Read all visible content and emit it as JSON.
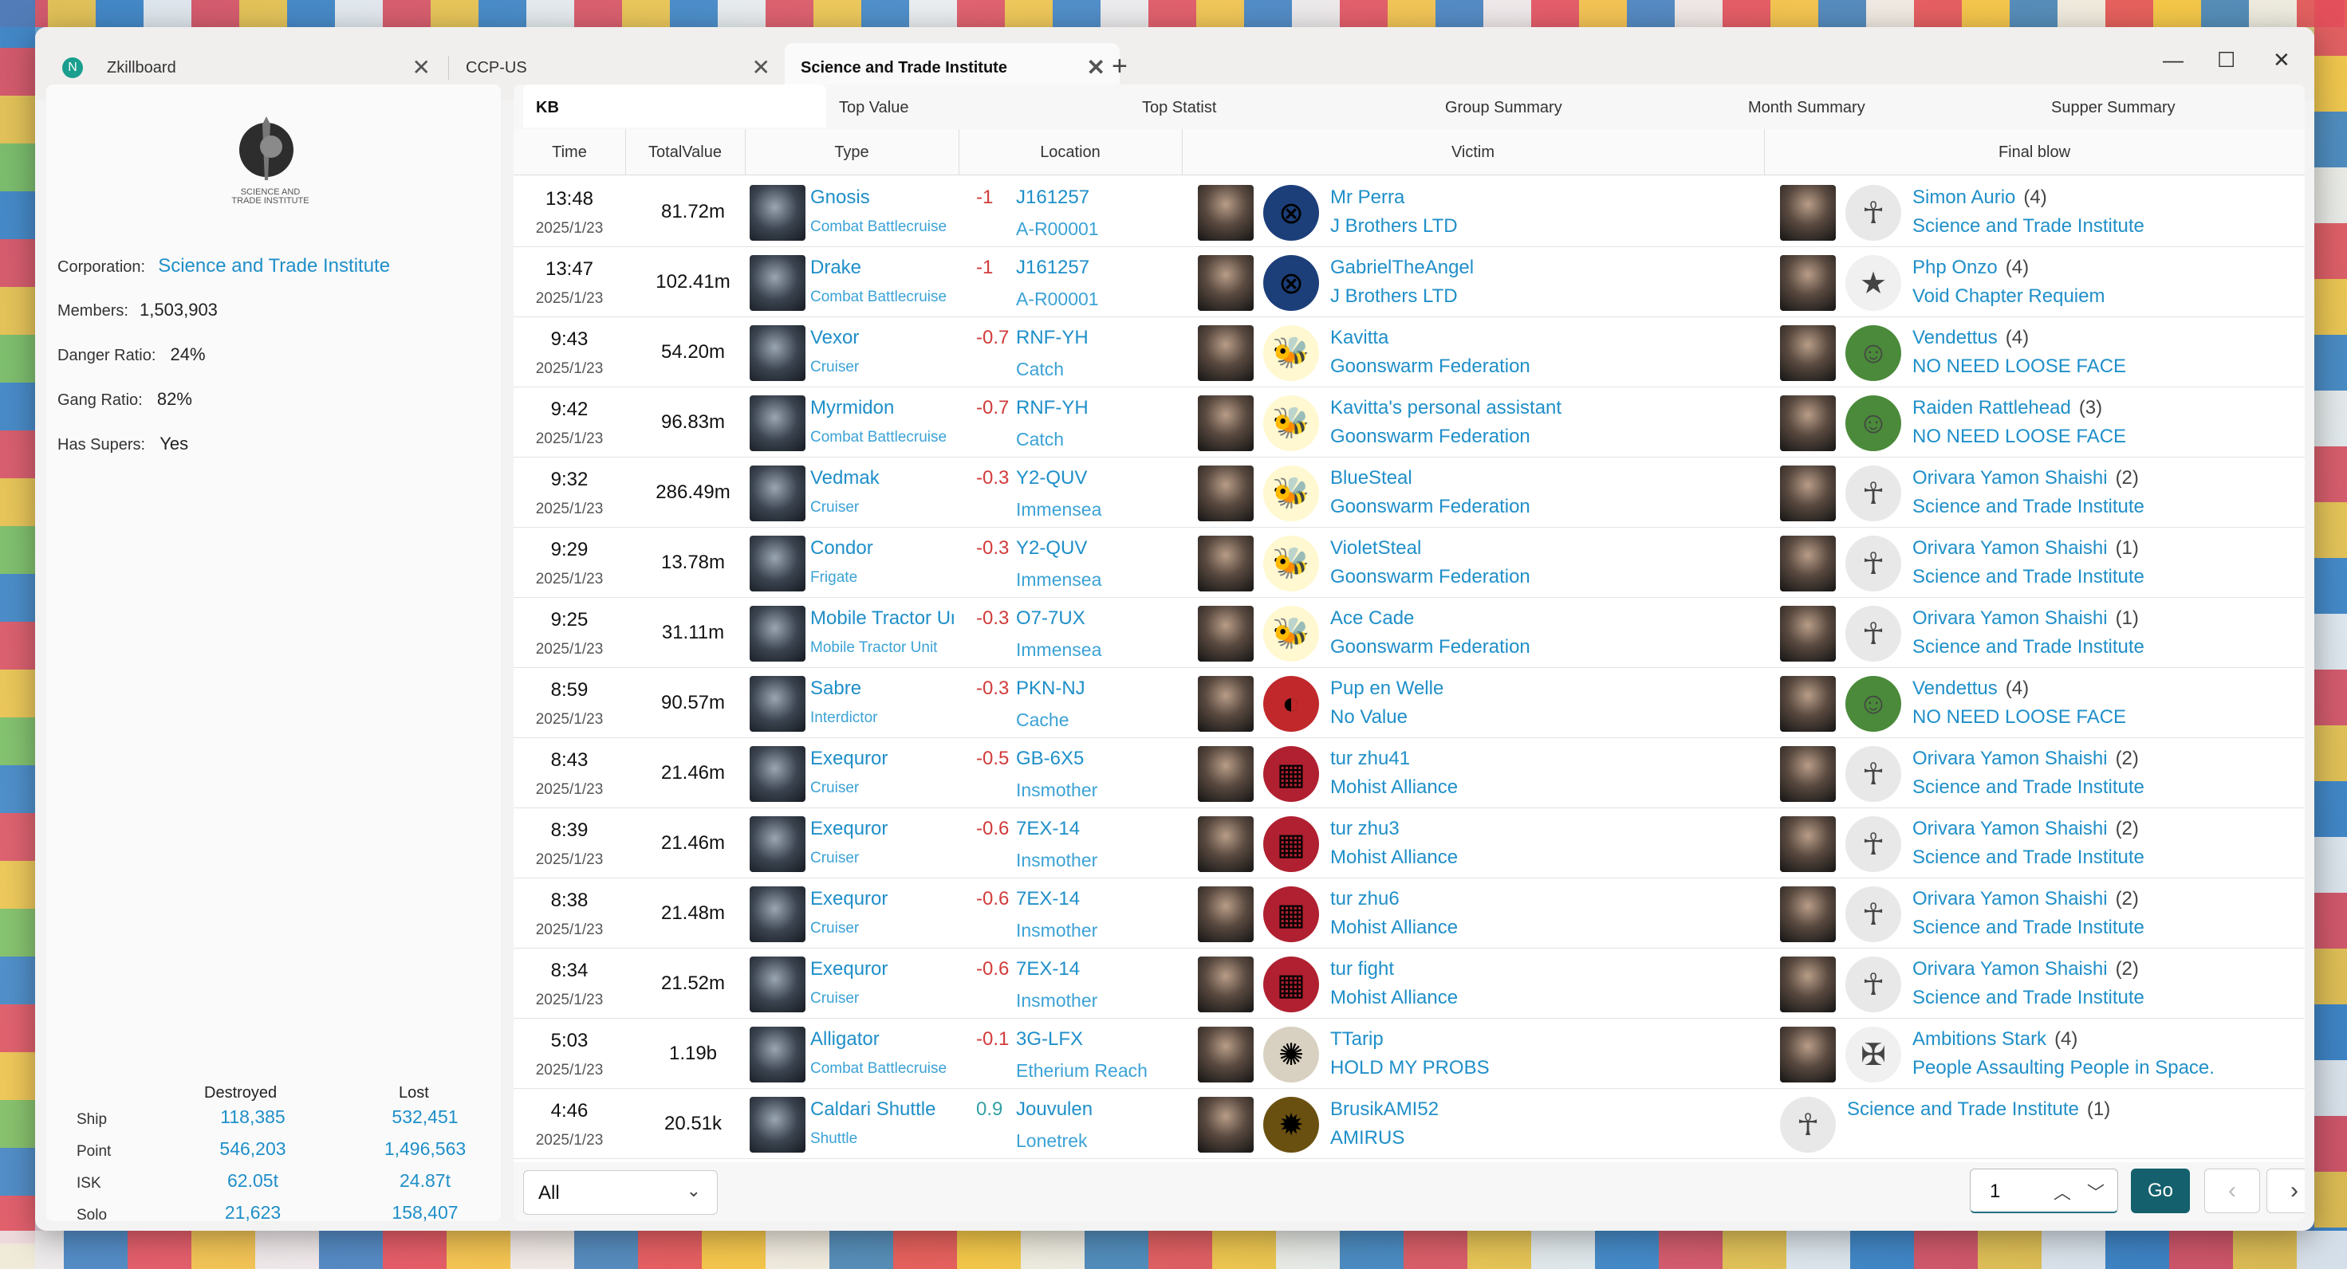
{
  "window": {
    "tabs": [
      {
        "label": "Zkillboard",
        "close": "✕",
        "app_initial": "N"
      },
      {
        "label": "CCP-US",
        "close": "✕"
      },
      {
        "label": "Science and Trade Institute",
        "close": "✕"
      }
    ],
    "new_tab": "+",
    "controls": {
      "minimize": "—",
      "maximize": "☐",
      "close": "✕"
    }
  },
  "corp": {
    "logo_text": "SCIENCE AND TRADE INSTITUTE",
    "corporation_label": "Corporation",
    "corporation_value": "Science and Trade Institute",
    "members_label": "Members",
    "members_value": "1,503,903",
    "danger_label": "Danger Ratio",
    "danger_value": "24%",
    "gang_label": "Gang Ratio",
    "gang_value": "82%",
    "supers_label": "Has Supers",
    "supers_value": "Yes"
  },
  "stats": {
    "destroyed_header": "Destroyed",
    "lost_header": "Lost",
    "rows": [
      {
        "label": "Ship",
        "destroyed": "118,385",
        "lost": "532,451"
      },
      {
        "label": "Point",
        "destroyed": "546,203",
        "lost": "1,496,563"
      },
      {
        "label": "ISK",
        "destroyed": "62.05t",
        "lost": "24.87t"
      },
      {
        "label": "Solo",
        "destroyed": "21,623",
        "lost": "158,407"
      }
    ]
  },
  "subtabs": [
    "KB",
    "Top Value",
    "Top Statist",
    "Group Summary",
    "Month Summary",
    "Supper Summary"
  ],
  "columns": {
    "time": "Time",
    "total": "TotalValue",
    "type": "Type",
    "location": "Location",
    "victim": "Victim",
    "final": "Final blow"
  },
  "kills": [
    {
      "time": "13:48",
      "date": "2025/1/23",
      "value": "81.72m",
      "ship": "Gnosis",
      "class": "Combat Battlecruise",
      "sec": "-1",
      "sys": "J161257",
      "region": "A-R00001",
      "victim": "Mr Perra",
      "vcorp": "J Brothers LTD",
      "vicon": "⊗",
      "vbg": "#1c3f7a",
      "final": "Simon Aurio",
      "fcount": "(4)",
      "fcorp": "Science and Trade Institute",
      "ficon": "☥",
      "fbg": "#e8e8e8"
    },
    {
      "time": "13:47",
      "date": "2025/1/23",
      "value": "102.41m",
      "ship": "Drake",
      "class": "Combat Battlecruise",
      "sec": "-1",
      "sys": "J161257",
      "region": "A-R00001",
      "victim": "GabrielTheAngel",
      "vcorp": "J Brothers LTD",
      "vicon": "⊗",
      "vbg": "#1c3f7a",
      "final": "Php Onzo",
      "fcount": "(4)",
      "fcorp": "Void Chapter Requiem",
      "ficon": "★",
      "fbg": "#f0f0f0"
    },
    {
      "time": "9:43",
      "date": "2025/1/23",
      "value": "54.20m",
      "ship": "Vexor",
      "class": "Cruiser",
      "sec": "-0.7",
      "sys": "RNF-YH",
      "region": "Catch",
      "victim": "Kavitta",
      "vcorp": "Goonswarm Federation",
      "vicon": "🐝",
      "vbg": "#fff8d0",
      "final": "Vendettus",
      "fcount": "(4)",
      "fcorp": "NO NEED LOOSE FACE",
      "ficon": "☺",
      "fbg": "#4a8a3a"
    },
    {
      "time": "9:42",
      "date": "2025/1/23",
      "value": "96.83m",
      "ship": "Myrmidon",
      "class": "Combat Battlecruise",
      "sec": "-0.7",
      "sys": "RNF-YH",
      "region": "Catch",
      "victim": "Kavitta's personal assistant",
      "vcorp": "Goonswarm Federation",
      "vicon": "🐝",
      "vbg": "#fff8d0",
      "final": "Raiden Rattlehead",
      "fcount": "(3)",
      "fcorp": "NO NEED LOOSE FACE",
      "ficon": "☺",
      "fbg": "#4a8a3a"
    },
    {
      "time": "9:32",
      "date": "2025/1/23",
      "value": "286.49m",
      "ship": "Vedmak",
      "class": "Cruiser",
      "sec": "-0.3",
      "sys": "Y2-QUV",
      "region": "Immensea",
      "victim": "BlueSteal",
      "vcorp": "Goonswarm Federation",
      "vicon": "🐝",
      "vbg": "#fff8d0",
      "final": "Orivara Yamon Shaishi",
      "fcount": "(2)",
      "fcorp": "Science and Trade Institute",
      "ficon": "☥",
      "fbg": "#e8e8e8"
    },
    {
      "time": "9:29",
      "date": "2025/1/23",
      "value": "13.78m",
      "ship": "Condor",
      "class": "Frigate",
      "sec": "-0.3",
      "sys": "Y2-QUV",
      "region": "Immensea",
      "victim": "VioletSteal",
      "vcorp": "Goonswarm Federation",
      "vicon": "🐝",
      "vbg": "#fff8d0",
      "final": "Orivara Yamon Shaishi",
      "fcount": "(1)",
      "fcorp": "Science and Trade Institute",
      "ficon": "☥",
      "fbg": "#e8e8e8"
    },
    {
      "time": "9:25",
      "date": "2025/1/23",
      "value": "31.11m",
      "ship": "Mobile Tractor Unit",
      "class": "Mobile Tractor Unit",
      "sec": "-0.3",
      "sys": "O7-7UX",
      "region": "Immensea",
      "victim": "Ace Cade",
      "vcorp": "Goonswarm Federation",
      "vicon": "🐝",
      "vbg": "#fff8d0",
      "final": "Orivara Yamon Shaishi",
      "fcount": "(1)",
      "fcorp": "Science and Trade Institute",
      "ficon": "☥",
      "fbg": "#e8e8e8"
    },
    {
      "time": "8:59",
      "date": "2025/1/23",
      "value": "90.57m",
      "ship": "Sabre",
      "class": "Interdictor",
      "sec": "-0.3",
      "sys": "PKN-NJ",
      "region": "Cache",
      "victim": "Pup en Welle",
      "vcorp": "No Value",
      "vicon": "◐",
      "vbg": "#c0282b",
      "final": "Vendettus",
      "fcount": "(4)",
      "fcorp": "NO NEED LOOSE FACE",
      "ficon": "☺",
      "fbg": "#4a8a3a"
    },
    {
      "time": "8:43",
      "date": "2025/1/23",
      "value": "21.46m",
      "ship": "Exequror",
      "class": "Cruiser",
      "sec": "-0.5",
      "sys": "GB-6X5",
      "region": "Insmother",
      "victim": "tur zhu41",
      "vcorp": "Mohist Alliance",
      "vicon": "▦",
      "vbg": "#b02030",
      "final": "Orivara Yamon Shaishi",
      "fcount": "(2)",
      "fcorp": "Science and Trade Institute",
      "ficon": "☥",
      "fbg": "#e8e8e8"
    },
    {
      "time": "8:39",
      "date": "2025/1/23",
      "value": "21.46m",
      "ship": "Exequror",
      "class": "Cruiser",
      "sec": "-0.6",
      "sys": "7EX-14",
      "region": "Insmother",
      "victim": "tur zhu3",
      "vcorp": "Mohist Alliance",
      "vicon": "▦",
      "vbg": "#b02030",
      "final": "Orivara Yamon Shaishi",
      "fcount": "(2)",
      "fcorp": "Science and Trade Institute",
      "ficon": "☥",
      "fbg": "#e8e8e8"
    },
    {
      "time": "8:38",
      "date": "2025/1/23",
      "value": "21.48m",
      "ship": "Exequror",
      "class": "Cruiser",
      "sec": "-0.6",
      "sys": "7EX-14",
      "region": "Insmother",
      "victim": "tur zhu6",
      "vcorp": "Mohist Alliance",
      "vicon": "▦",
      "vbg": "#b02030",
      "final": "Orivara Yamon Shaishi",
      "fcount": "(2)",
      "fcorp": "Science and Trade Institute",
      "ficon": "☥",
      "fbg": "#e8e8e8"
    },
    {
      "time": "8:34",
      "date": "2025/1/23",
      "value": "21.52m",
      "ship": "Exequror",
      "class": "Cruiser",
      "sec": "-0.6",
      "sys": "7EX-14",
      "region": "Insmother",
      "victim": "tur fight",
      "vcorp": "Mohist Alliance",
      "vicon": "▦",
      "vbg": "#b02030",
      "final": "Orivara Yamon Shaishi",
      "fcount": "(2)",
      "fcorp": "Science and Trade Institute",
      "ficon": "☥",
      "fbg": "#e8e8e8"
    },
    {
      "time": "5:03",
      "date": "2025/1/23",
      "value": "1.19b",
      "ship": "Alligator",
      "class": "Combat Battlecruise",
      "sec": "-0.1",
      "sys": "3G-LFX",
      "region": "Etherium Reach",
      "victim": "TTarip",
      "vcorp": "HOLD MY PROBS",
      "vicon": "✺",
      "vbg": "#d8d0c0",
      "final": "Ambitions Stark",
      "fcount": "(4)",
      "fcorp": "People Assaulting People in Space.",
      "ficon": "✠",
      "fbg": "#f0f0f0"
    },
    {
      "time": "4:46",
      "date": "2025/1/23",
      "value": "20.51k",
      "ship": "Caldari Shuttle",
      "class": "Shuttle",
      "sec": "0.9",
      "sys": "Jouvulen",
      "region": "Lonetrek",
      "victim": "BrusikAMI52",
      "vcorp": "AMIRUS",
      "vicon": "✹",
      "vbg": "#6a5010",
      "final": "Science and Trade Institute",
      "fcount": "(1)",
      "fcorp": "",
      "ficon": "☥",
      "fbg": "#e8e8e8",
      "final_no_portrait": true
    }
  ],
  "bottom": {
    "filter": "All",
    "page": "1",
    "go": "Go",
    "prev": "‹",
    "next": "›"
  }
}
